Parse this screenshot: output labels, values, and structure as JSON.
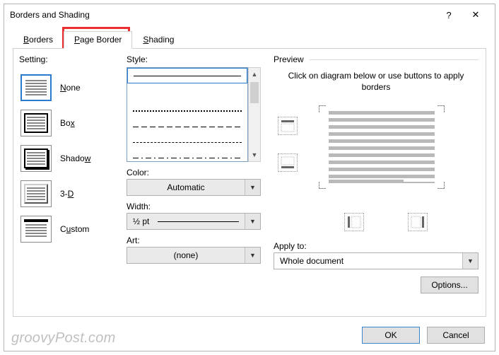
{
  "titlebar": {
    "title": "Borders and Shading",
    "help": "?",
    "close": "✕"
  },
  "tabs": {
    "borders": "Borders",
    "pageborder": "Page Border",
    "shading": "Shading",
    "active": "pageborder"
  },
  "setting": {
    "label": "Setting:",
    "items": [
      {
        "label": "None",
        "accel": "N"
      },
      {
        "label": "Box",
        "accel": ""
      },
      {
        "label": "Shadow",
        "accel": ""
      },
      {
        "label": "3-D",
        "accel": "D"
      },
      {
        "label": "Custom",
        "accel": "u"
      }
    ]
  },
  "style": {
    "label": "Style:",
    "color_label": "Color:",
    "color_value": "Automatic",
    "width_label": "Width:",
    "width_value": "½ pt",
    "art_label": "Art:",
    "art_value": "(none)"
  },
  "preview": {
    "label": "Preview",
    "hint": "Click on diagram below or use buttons to apply borders",
    "apply_label": "Apply to:",
    "apply_value": "Whole document",
    "options": "Options..."
  },
  "buttons": {
    "ok": "OK",
    "cancel": "Cancel"
  },
  "watermark": "groovyPost.com"
}
